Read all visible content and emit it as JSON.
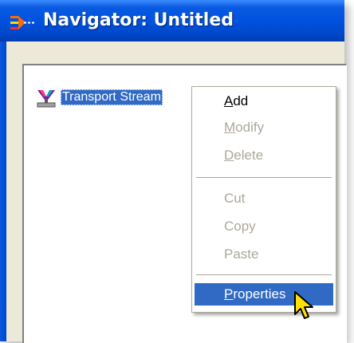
{
  "window": {
    "title": "Navigator: Untitled",
    "app_icon": "navigator-network-icon"
  },
  "tree": {
    "nodes": [
      {
        "label": "Transport Stream",
        "icon": "transport-stream-icon",
        "selected": true
      }
    ]
  },
  "context_menu": {
    "items": [
      {
        "label": "Add",
        "mnemonic": "A",
        "rest": "dd",
        "enabled": true
      },
      {
        "label": "Modify",
        "mnemonic": "M",
        "rest": "odify",
        "enabled": false
      },
      {
        "label": "Delete",
        "mnemonic": "D",
        "rest": "elete",
        "enabled": false
      },
      {
        "label": "Cut",
        "enabled": false
      },
      {
        "label": "Copy",
        "enabled": false
      },
      {
        "label": "Paste",
        "enabled": false
      },
      {
        "label": "Properties",
        "mnemonic": "P",
        "rest": "roperties",
        "enabled": true,
        "highlighted": true
      }
    ]
  },
  "colors": {
    "title_bar": "#0052e0",
    "selection": "#316ac5",
    "disabled_text": "#aca899",
    "window_bg": "#ece9d8"
  },
  "cursor": {
    "icon": "arrow-pointer-icon"
  }
}
